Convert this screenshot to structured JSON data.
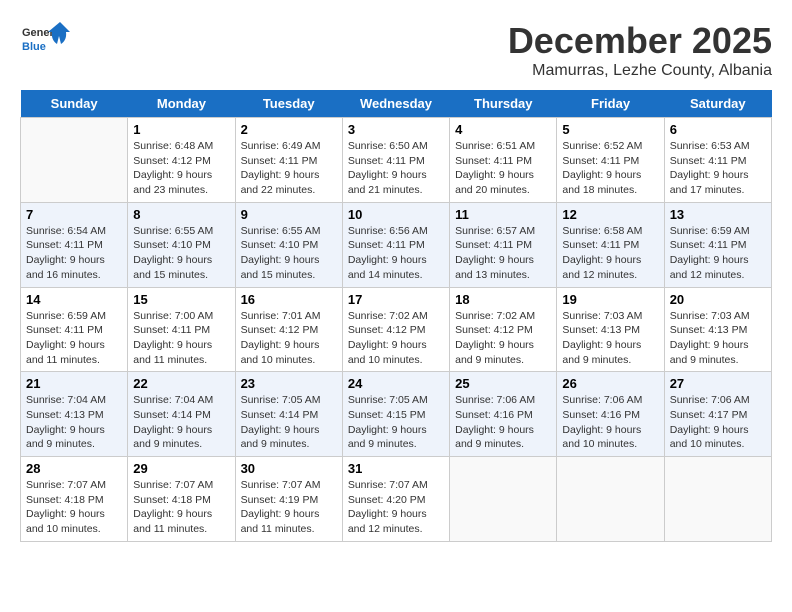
{
  "header": {
    "logo_general": "General",
    "logo_blue": "Blue",
    "month_year": "December 2025",
    "location": "Mamurras, Lezhe County, Albania"
  },
  "days_of_week": [
    "Sunday",
    "Monday",
    "Tuesday",
    "Wednesday",
    "Thursday",
    "Friday",
    "Saturday"
  ],
  "weeks": [
    [
      {
        "day": "",
        "sunrise": "",
        "sunset": "",
        "daylight": ""
      },
      {
        "day": "1",
        "sunrise": "Sunrise: 6:48 AM",
        "sunset": "Sunset: 4:12 PM",
        "daylight": "Daylight: 9 hours and 23 minutes."
      },
      {
        "day": "2",
        "sunrise": "Sunrise: 6:49 AM",
        "sunset": "Sunset: 4:11 PM",
        "daylight": "Daylight: 9 hours and 22 minutes."
      },
      {
        "day": "3",
        "sunrise": "Sunrise: 6:50 AM",
        "sunset": "Sunset: 4:11 PM",
        "daylight": "Daylight: 9 hours and 21 minutes."
      },
      {
        "day": "4",
        "sunrise": "Sunrise: 6:51 AM",
        "sunset": "Sunset: 4:11 PM",
        "daylight": "Daylight: 9 hours and 20 minutes."
      },
      {
        "day": "5",
        "sunrise": "Sunrise: 6:52 AM",
        "sunset": "Sunset: 4:11 PM",
        "daylight": "Daylight: 9 hours and 18 minutes."
      },
      {
        "day": "6",
        "sunrise": "Sunrise: 6:53 AM",
        "sunset": "Sunset: 4:11 PM",
        "daylight": "Daylight: 9 hours and 17 minutes."
      }
    ],
    [
      {
        "day": "7",
        "sunrise": "Sunrise: 6:54 AM",
        "sunset": "Sunset: 4:11 PM",
        "daylight": "Daylight: 9 hours and 16 minutes."
      },
      {
        "day": "8",
        "sunrise": "Sunrise: 6:55 AM",
        "sunset": "Sunset: 4:10 PM",
        "daylight": "Daylight: 9 hours and 15 minutes."
      },
      {
        "day": "9",
        "sunrise": "Sunrise: 6:55 AM",
        "sunset": "Sunset: 4:10 PM",
        "daylight": "Daylight: 9 hours and 15 minutes."
      },
      {
        "day": "10",
        "sunrise": "Sunrise: 6:56 AM",
        "sunset": "Sunset: 4:11 PM",
        "daylight": "Daylight: 9 hours and 14 minutes."
      },
      {
        "day": "11",
        "sunrise": "Sunrise: 6:57 AM",
        "sunset": "Sunset: 4:11 PM",
        "daylight": "Daylight: 9 hours and 13 minutes."
      },
      {
        "day": "12",
        "sunrise": "Sunrise: 6:58 AM",
        "sunset": "Sunset: 4:11 PM",
        "daylight": "Daylight: 9 hours and 12 minutes."
      },
      {
        "day": "13",
        "sunrise": "Sunrise: 6:59 AM",
        "sunset": "Sunset: 4:11 PM",
        "daylight": "Daylight: 9 hours and 12 minutes."
      }
    ],
    [
      {
        "day": "14",
        "sunrise": "Sunrise: 6:59 AM",
        "sunset": "Sunset: 4:11 PM",
        "daylight": "Daylight: 9 hours and 11 minutes."
      },
      {
        "day": "15",
        "sunrise": "Sunrise: 7:00 AM",
        "sunset": "Sunset: 4:11 PM",
        "daylight": "Daylight: 9 hours and 11 minutes."
      },
      {
        "day": "16",
        "sunrise": "Sunrise: 7:01 AM",
        "sunset": "Sunset: 4:12 PM",
        "daylight": "Daylight: 9 hours and 10 minutes."
      },
      {
        "day": "17",
        "sunrise": "Sunrise: 7:02 AM",
        "sunset": "Sunset: 4:12 PM",
        "daylight": "Daylight: 9 hours and 10 minutes."
      },
      {
        "day": "18",
        "sunrise": "Sunrise: 7:02 AM",
        "sunset": "Sunset: 4:12 PM",
        "daylight": "Daylight: 9 hours and 9 minutes."
      },
      {
        "day": "19",
        "sunrise": "Sunrise: 7:03 AM",
        "sunset": "Sunset: 4:13 PM",
        "daylight": "Daylight: 9 hours and 9 minutes."
      },
      {
        "day": "20",
        "sunrise": "Sunrise: 7:03 AM",
        "sunset": "Sunset: 4:13 PM",
        "daylight": "Daylight: 9 hours and 9 minutes."
      }
    ],
    [
      {
        "day": "21",
        "sunrise": "Sunrise: 7:04 AM",
        "sunset": "Sunset: 4:13 PM",
        "daylight": "Daylight: 9 hours and 9 minutes."
      },
      {
        "day": "22",
        "sunrise": "Sunrise: 7:04 AM",
        "sunset": "Sunset: 4:14 PM",
        "daylight": "Daylight: 9 hours and 9 minutes."
      },
      {
        "day": "23",
        "sunrise": "Sunrise: 7:05 AM",
        "sunset": "Sunset: 4:14 PM",
        "daylight": "Daylight: 9 hours and 9 minutes."
      },
      {
        "day": "24",
        "sunrise": "Sunrise: 7:05 AM",
        "sunset": "Sunset: 4:15 PM",
        "daylight": "Daylight: 9 hours and 9 minutes."
      },
      {
        "day": "25",
        "sunrise": "Sunrise: 7:06 AM",
        "sunset": "Sunset: 4:16 PM",
        "daylight": "Daylight: 9 hours and 9 minutes."
      },
      {
        "day": "26",
        "sunrise": "Sunrise: 7:06 AM",
        "sunset": "Sunset: 4:16 PM",
        "daylight": "Daylight: 9 hours and 10 minutes."
      },
      {
        "day": "27",
        "sunrise": "Sunrise: 7:06 AM",
        "sunset": "Sunset: 4:17 PM",
        "daylight": "Daylight: 9 hours and 10 minutes."
      }
    ],
    [
      {
        "day": "28",
        "sunrise": "Sunrise: 7:07 AM",
        "sunset": "Sunset: 4:18 PM",
        "daylight": "Daylight: 9 hours and 10 minutes."
      },
      {
        "day": "29",
        "sunrise": "Sunrise: 7:07 AM",
        "sunset": "Sunset: 4:18 PM",
        "daylight": "Daylight: 9 hours and 11 minutes."
      },
      {
        "day": "30",
        "sunrise": "Sunrise: 7:07 AM",
        "sunset": "Sunset: 4:19 PM",
        "daylight": "Daylight: 9 hours and 11 minutes."
      },
      {
        "day": "31",
        "sunrise": "Sunrise: 7:07 AM",
        "sunset": "Sunset: 4:20 PM",
        "daylight": "Daylight: 9 hours and 12 minutes."
      },
      {
        "day": "",
        "sunrise": "",
        "sunset": "",
        "daylight": ""
      },
      {
        "day": "",
        "sunrise": "",
        "sunset": "",
        "daylight": ""
      },
      {
        "day": "",
        "sunrise": "",
        "sunset": "",
        "daylight": ""
      }
    ]
  ]
}
